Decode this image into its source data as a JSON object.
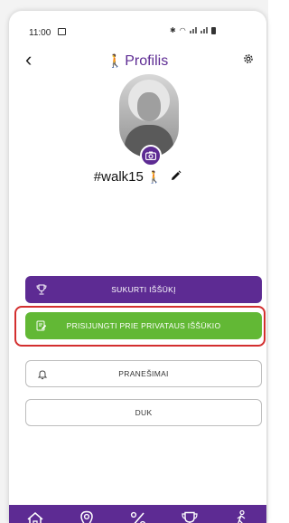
{
  "status_bar": {
    "time": "11:00"
  },
  "header": {
    "title": "Profilis"
  },
  "profile": {
    "username": "#walk15",
    "badge_emoji": "🚶"
  },
  "buttons": {
    "create_challenge": "SUKURTI IŠŠŪKĮ",
    "join_private": "PRISIJUNGTI PRIE PRIVATAUS IŠŠŪKIO",
    "notifications": "PRANEŠIMAI",
    "faq": "DUK"
  },
  "nav": {
    "items": [
      {
        "icon": "home-icon"
      },
      {
        "icon": "location-pin-icon"
      },
      {
        "icon": "percent-icon"
      },
      {
        "icon": "trophy-icon"
      },
      {
        "icon": "walker-icon"
      }
    ]
  },
  "colors": {
    "purple": "#5d2b93",
    "green": "#62b835",
    "highlight": "#d32f2f"
  }
}
